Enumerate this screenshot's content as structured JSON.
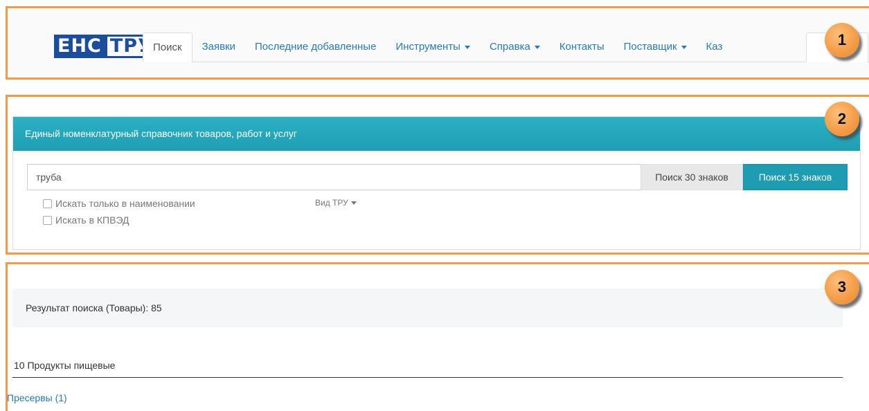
{
  "brand": {
    "logo_part1": "ЕНС",
    "logo_part2": "ТРУ"
  },
  "nav": {
    "tabs": [
      {
        "label": "Поиск",
        "active": true
      },
      {
        "label": "Заявки"
      },
      {
        "label": "Последние добавленные"
      },
      {
        "label": "Инструменты",
        "dropdown": true
      },
      {
        "label": "Справка",
        "dropdown": true
      },
      {
        "label": "Контакты"
      },
      {
        "label": "Поставщик",
        "dropdown": true
      },
      {
        "label": "Каз"
      }
    ]
  },
  "panel": {
    "heading": "Единый номенклатурный справочник товаров, работ и услуг",
    "search_value": "труба",
    "btn_30": "Поиск 30 знаков",
    "btn_15": "Поиск 15 знаков",
    "check_name_only": "Искать только в наименовании",
    "check_kpved": "Искать в КПВЭД",
    "vid_tru": "Вид ТРУ"
  },
  "results": {
    "summary": "Результат поиска (Товары): 85",
    "category": "10 Продукты пищевые",
    "first_link": "Пресервы (1)"
  },
  "annotations": [
    "1",
    "2",
    "3"
  ],
  "colors": {
    "accent_orange": "#f4994a",
    "panel_teal": "#1e9db2",
    "link_blue": "#2a7ab9",
    "logo_blue": "#1b4d9c"
  }
}
